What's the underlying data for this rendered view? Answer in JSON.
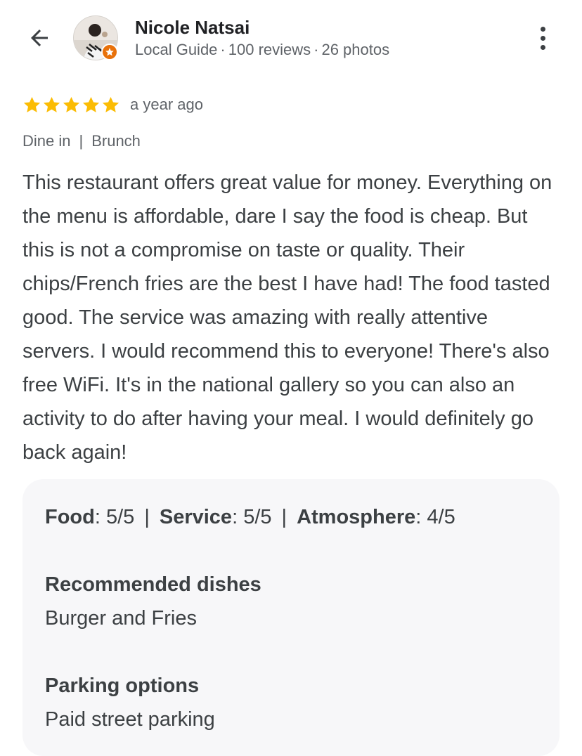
{
  "header": {
    "back_icon": "arrow-left-icon",
    "user_name": "Nicole Natsai",
    "user_level": "Local Guide",
    "reviews": "100 reviews",
    "photos": "26 photos",
    "separator": "·",
    "more_icon": "more-vert-icon",
    "badge_color": "#e8710a"
  },
  "review": {
    "rating": 5,
    "max_rating": 5,
    "star_color": "#fbbc04",
    "time_ago": "a year ago",
    "tags": [
      "Dine in",
      "Brunch"
    ],
    "tag_separator": "|",
    "text": "This restaurant offers great value for money. Everything on the menu is affordable, dare I say the food is cheap. But this is not a compromise on taste or quality. Their chips/French fries are the best I have had! The food tasted good. The service was amazing with really attentive servers. I would recommend this to everyone! There's also free WiFi. It's in the national gallery so you can also an activity to do after having your meal. I would definitely go back again!"
  },
  "details": {
    "scores": [
      {
        "label": "Food",
        "value": "5/5"
      },
      {
        "label": "Service",
        "value": "5/5"
      },
      {
        "label": "Atmosphere",
        "value": "4/5"
      }
    ],
    "score_separator": "|",
    "recommended_title": "Recommended dishes",
    "recommended_value": "Burger and Fries",
    "parking_title": "Parking options",
    "parking_value": "Paid street parking"
  }
}
